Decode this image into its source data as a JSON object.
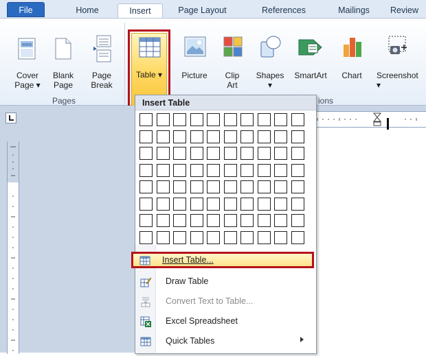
{
  "tabs": [
    {
      "label": "File"
    },
    {
      "label": "Home"
    },
    {
      "label": "Insert"
    },
    {
      "label": "Page Layout"
    },
    {
      "label": "References"
    },
    {
      "label": "Mailings"
    },
    {
      "label": "Review"
    }
  ],
  "ribbon": {
    "buttons": [
      {
        "label": "Cover\nPage ▾",
        "icon": "cover-page-icon"
      },
      {
        "label": "Blank\nPage",
        "icon": "blank-page-icon"
      },
      {
        "label": "Page\nBreak",
        "icon": "page-break-icon"
      },
      {
        "label": "Table\n▾",
        "icon": "table-icon"
      },
      {
        "label": "Picture",
        "icon": "picture-icon"
      },
      {
        "label": "Clip\nArt",
        "icon": "clip-art-icon"
      },
      {
        "label": "Shapes\n▾",
        "icon": "shapes-icon"
      },
      {
        "label": "SmartArt",
        "icon": "smartart-icon"
      },
      {
        "label": "Chart",
        "icon": "chart-icon"
      },
      {
        "label": "Screenshot\n▾",
        "icon": "screenshot-icon"
      }
    ],
    "groups": [
      {
        "label": "Pages"
      },
      {
        "label": "ions"
      }
    ]
  },
  "dropdown": {
    "title": "Insert Table",
    "grid_cols": 10,
    "grid_rows": 8,
    "items": [
      {
        "label": "Insert Table...",
        "icon": "insert-table-icon",
        "highlighted": true,
        "disabled": false
      },
      {
        "label": "Draw Table",
        "icon": "draw-table-icon",
        "highlighted": false,
        "disabled": false
      },
      {
        "label": "Convert Text to Table...",
        "icon": "convert-text-icon",
        "highlighted": false,
        "disabled": true
      },
      {
        "label": "Excel Spreadsheet",
        "icon": "excel-spreadsheet-icon",
        "highlighted": false,
        "disabled": false
      },
      {
        "label": "Quick Tables",
        "icon": "quick-tables-icon",
        "highlighted": false,
        "disabled": false,
        "submenu": true
      }
    ]
  },
  "colors": {
    "highlight_border": "#b5121b",
    "file_tab": "#2a6bc1",
    "menu_highlight": "#ffe48a"
  }
}
